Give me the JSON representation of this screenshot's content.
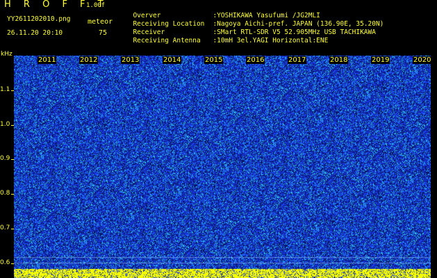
{
  "header": {
    "app_title": "H R O F F T",
    "version": "1.00f",
    "filename": "YY2611202010.png",
    "event_label": "meteor",
    "datetime": "26.11.20 20:10",
    "event_count": "75"
  },
  "info": [
    {
      "key": "Overver",
      "value": ":YOSHIKAWA Yasufumi /JG2MLI"
    },
    {
      "key": "Receiving Location",
      "value": ":Nagoya Aichi-pref. JAPAN (136.90E, 35.20N)"
    },
    {
      "key": "Receiver",
      "value": ":SMart RTL-SDR V5 52.905MHz USB TACHIKAWA"
    },
    {
      "key": "Receiving Antenna",
      "value": ":10mH 3el.YAGI Horizontal:ENE"
    }
  ],
  "axis": {
    "unit": "kHz",
    "y_ticks": [
      "1.1",
      "1.0",
      "0.9",
      "0.8",
      "0.7",
      "0.6"
    ],
    "x_labels": [
      "2011",
      "2012",
      "2013",
      "2014",
      "2015",
      "2016",
      "2017",
      "2018",
      "2019",
      "2020"
    ]
  },
  "colors": {
    "background": "#000000",
    "text": "#ffff33",
    "noise_dark": "#0a1a70",
    "noise_mid": "#1e3cff",
    "noise_bright": "#22c0ff",
    "strip": "#f6ff00"
  }
}
